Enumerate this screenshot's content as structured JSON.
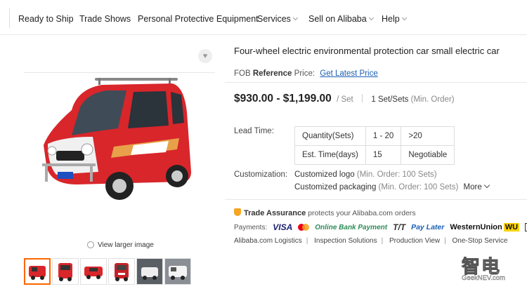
{
  "nav": {
    "items": [
      {
        "label": "Ready to Ship",
        "has_menu": false
      },
      {
        "label": "Trade Shows",
        "has_menu": false
      },
      {
        "label": "Personal Protective Equipment",
        "has_menu": false
      },
      {
        "label": "Services",
        "has_menu": true
      },
      {
        "label": "Sell on Alibaba",
        "has_menu": true
      },
      {
        "label": "Help",
        "has_menu": true
      }
    ]
  },
  "gallery": {
    "view_larger": "View larger image",
    "favorite_icon": "heart-icon",
    "thumbnail_count": 6,
    "selected_thumbnail": 1
  },
  "product": {
    "title": "Four-wheel electric environmental protection car small electric car",
    "fob_prefix": "FOB",
    "fob_bold": "Reference",
    "fob_suffix": "Price:",
    "fob_link": "Get Latest Price",
    "price_range": "$930.00 - $1,199.00",
    "price_unit": "/ Set",
    "moq_value": "1 Set/Sets",
    "moq_note": "(Min. Order)"
  },
  "lead_time": {
    "label": "Lead Time:",
    "rows": [
      [
        "Quantity(Sets)",
        "1 - 20",
        ">20"
      ],
      [
        "Est. Time(days)",
        "15",
        "Negotiable"
      ]
    ]
  },
  "customization": {
    "label": "Customization:",
    "logo": "Customized logo",
    "logo_moq": "(Min. Order: 100 Sets)",
    "packaging": "Customized packaging",
    "packaging_moq": "(Min. Order: 100 Sets)",
    "more": "More"
  },
  "trade_assurance": {
    "title": "Trade Assurance",
    "text": "protects your Alibaba.com orders"
  },
  "payments": {
    "label": "Payments:",
    "visa": "VISA",
    "bank": "Online Bank Payment",
    "tt": "T/T",
    "paylater": "Pay Later",
    "wu": "WesternUnion",
    "wu_badge": "WU"
  },
  "services": [
    "Alibaba.com Logistics",
    "Inspection Solutions",
    "Production View",
    "One-Stop Service"
  ],
  "watermark": {
    "top": "智电",
    "bottom": "GeekNEV.com"
  },
  "colors": {
    "accent": "#ff6a00",
    "link": "#1a5fb4",
    "car_red": "#d8262b"
  }
}
